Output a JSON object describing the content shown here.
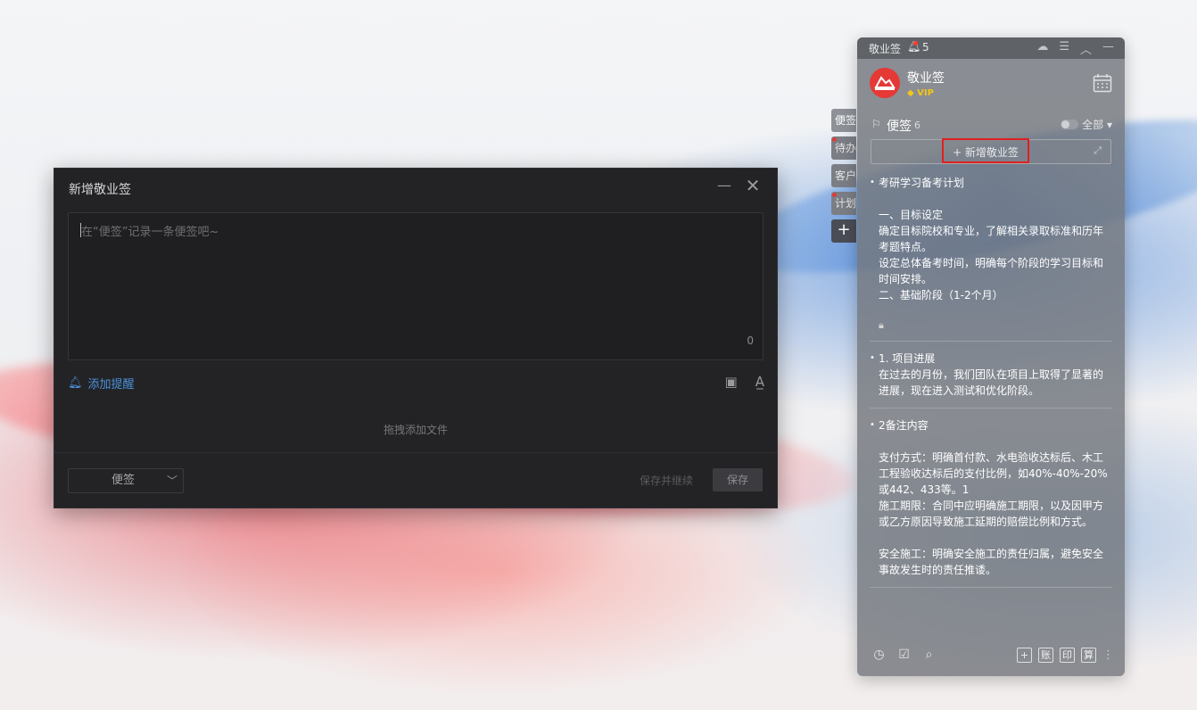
{
  "dialog": {
    "title": "新增敬业签",
    "minimize_icon": "minimize-icon",
    "close_icon": "close-icon",
    "placeholder": "在“便签”记录一条便签吧~",
    "char_count": "0",
    "add_reminder": "添加提醒",
    "drop_hint": "拖拽添加文件",
    "category": "便签",
    "save_continue": "保存并继续",
    "save": "保存"
  },
  "side_tabs": [
    {
      "label": "便签",
      "dot": false,
      "active": true
    },
    {
      "label": "待办",
      "dot": true,
      "active": false
    },
    {
      "label": "客户",
      "dot": false,
      "active": false
    },
    {
      "label": "计划",
      "dot": true,
      "active": false
    },
    {
      "label": "+",
      "dot": false,
      "active": false
    }
  ],
  "panel": {
    "app_name": "敬业签",
    "bell_count": "5",
    "user_name": "敬业签",
    "vip_label": "VIP",
    "list_title": "便签",
    "list_count": "6",
    "filter": "全部",
    "add_button": "+ 新增敬业签",
    "notes": [
      {
        "title": "考研学习备考计划",
        "body": "\n一、目标设定\n确定目标院校和专业，了解相关录取标准和历年考题特点。\n设定总体备考时间，明确每个阶段的学习目标和时间安排。\n二、基础阶段（1-2个月）\n\n英语：\n每日背诵单词，增加词汇量。"
      },
      {
        "title": "1. 项目进展",
        "body": " 在过去的月份，我们团队在项目上取得了显著的进展，现在进入测试和优化阶段。"
      },
      {
        "title": "2备注内容",
        "body": "\n支付方式：明确首付款、水电验收达标后、木工工程验收达标后的支付比例，如40%-40%-20%或442、433等。1\n施工期限：合同中应明确施工期限，以及因甲方或乙方原因导致施工延期的赔偿比例和方式。\n\n安全施工：明确安全施工的责任归属，避免安全事故发生时的责任推诿。"
      }
    ],
    "footer_right": [
      "+",
      "账",
      "印",
      "算"
    ]
  }
}
